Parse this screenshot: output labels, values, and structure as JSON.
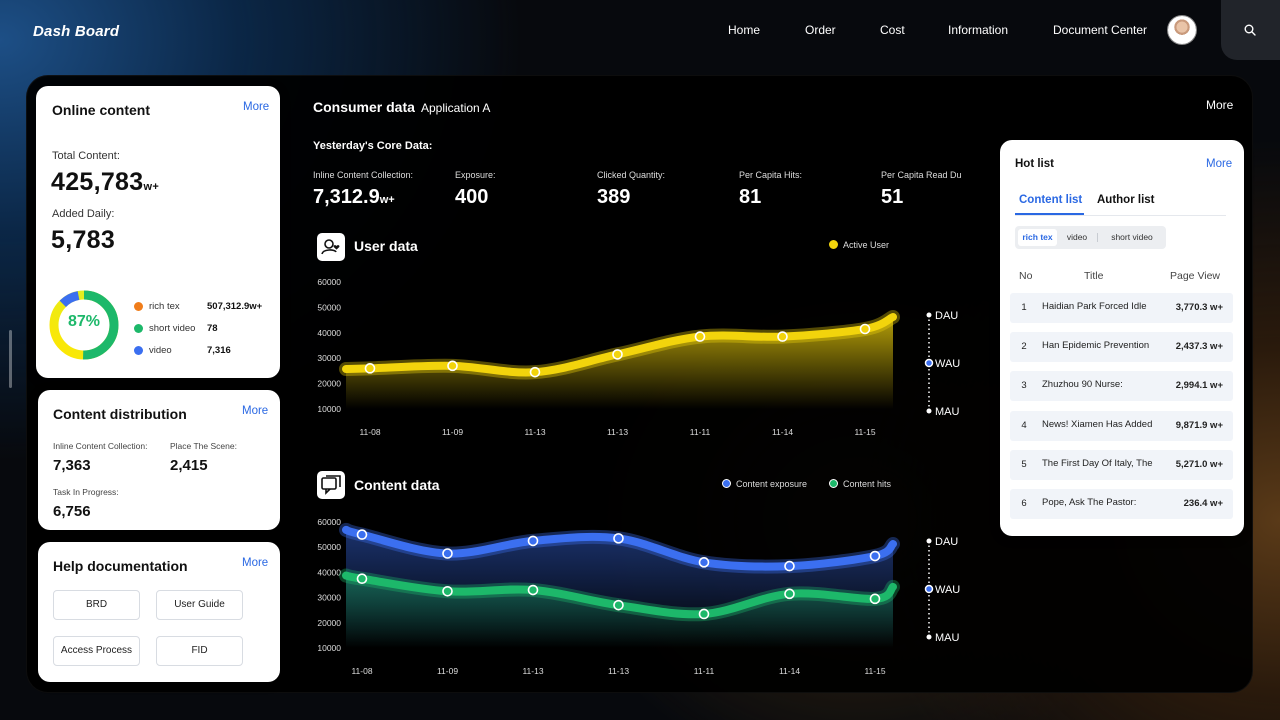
{
  "header": {
    "logo": "Dash Board",
    "nav": [
      "Home",
      "Order",
      "Cost",
      "Information",
      "Document Center"
    ]
  },
  "online_content": {
    "title": "Online content",
    "more": "More",
    "total_label": "Total Content:",
    "total_value": "425,783",
    "total_unit": "w+",
    "daily_label": "Added Daily:",
    "daily_value": "5,783",
    "percent": "87%",
    "legend": [
      {
        "name": "rich tex",
        "value": "507,312.9w+",
        "color": "#f07d1a"
      },
      {
        "name": "short video",
        "value": "78",
        "color": "#1db86a"
      },
      {
        "name": "video",
        "value": "7,316",
        "color": "#3b6ff0"
      }
    ]
  },
  "content_distribution": {
    "title": "Content distribution",
    "more": "More",
    "items": [
      {
        "label": "Inline Content Collection:",
        "value": "7,363"
      },
      {
        "label": "Place The Scene:",
        "value": "2,415"
      },
      {
        "label": "Task In Progress:",
        "value": "6,756"
      }
    ]
  },
  "help_documentation": {
    "title": "Help documentation",
    "more": "More",
    "buttons": [
      "BRD",
      "User Guide",
      "Access Process",
      "FID"
    ]
  },
  "consumer": {
    "title": "Consumer data",
    "app": "Application A",
    "more": "More",
    "core_title": "Yesterday's Core Data:",
    "metrics": [
      {
        "label": "Inline Content Collection:",
        "value": "7,312.9",
        "unit": "w+"
      },
      {
        "label": "Exposure:",
        "value": "400",
        "unit": ""
      },
      {
        "label": "Clicked Quantity:",
        "value": "389",
        "unit": ""
      },
      {
        "label": "Per Capita Hits:",
        "value": "81",
        "unit": ""
      },
      {
        "label": "Per Capita Read Duration:",
        "value": "51",
        "unit": ""
      }
    ]
  },
  "user_chart_title": "User data",
  "content_chart_title": "Content data",
  "scale_options": [
    "DAU",
    "WAU",
    "MAU"
  ],
  "scale_selected": "WAU",
  "chart_data": [
    {
      "type": "area",
      "title": "User data",
      "categories": [
        "11-08",
        "11-09",
        "11-13",
        "11-13",
        "11-11",
        "11-14",
        "11-15"
      ],
      "ylim": [
        10000,
        60000
      ],
      "yticks": [
        60000,
        50000,
        40000,
        30000,
        20000,
        10000
      ],
      "legend_position": "top-right",
      "series": [
        {
          "name": "Active User",
          "color": "#f2d40c",
          "values": [
            26000,
            27000,
            24500,
            31500,
            38500,
            38500,
            41500
          ]
        }
      ]
    },
    {
      "type": "area",
      "title": "Content data",
      "categories": [
        "11-08",
        "11-09",
        "11-13",
        "11-13",
        "11-11",
        "11-14",
        "11-15"
      ],
      "ylim": [
        10000,
        60000
      ],
      "yticks": [
        60000,
        50000,
        40000,
        30000,
        20000,
        10000
      ],
      "legend_position": "top-right",
      "series": [
        {
          "name": "Content exposure",
          "color": "#3b6ff0",
          "values": [
            55000,
            47500,
            52500,
            53500,
            44000,
            42500,
            46500
          ]
        },
        {
          "name": "Content hits",
          "color": "#1db86a",
          "values": [
            37500,
            32500,
            33000,
            27000,
            23500,
            31500,
            29500
          ]
        }
      ]
    }
  ],
  "hot_list": {
    "title": "Hot list",
    "more": "More",
    "tabs": [
      "Content list",
      "Author list"
    ],
    "segments": [
      "rich tex",
      "video",
      "short video"
    ],
    "headers": {
      "no": "No",
      "title": "Title",
      "pv": "Page View"
    },
    "rows": [
      {
        "no": "1",
        "title": "Haidian Park Forced Idle",
        "pv": "3,770.3 w+"
      },
      {
        "no": "2",
        "title": "Han Epidemic Prevention",
        "pv": "2,437.3 w+"
      },
      {
        "no": "3",
        "title": "Zhuzhou 90 Nurse:",
        "pv": "2,994.1 w+"
      },
      {
        "no": "4",
        "title": "News! Xiamen Has Added",
        "pv": "9,871.9 w+"
      },
      {
        "no": "5",
        "title": "The First Day Of Italy, The",
        "pv": "5,271.0 w+"
      },
      {
        "no": "6",
        "title": "Pope, Ask The Pastor:",
        "pv": "236.4 w+"
      }
    ]
  }
}
